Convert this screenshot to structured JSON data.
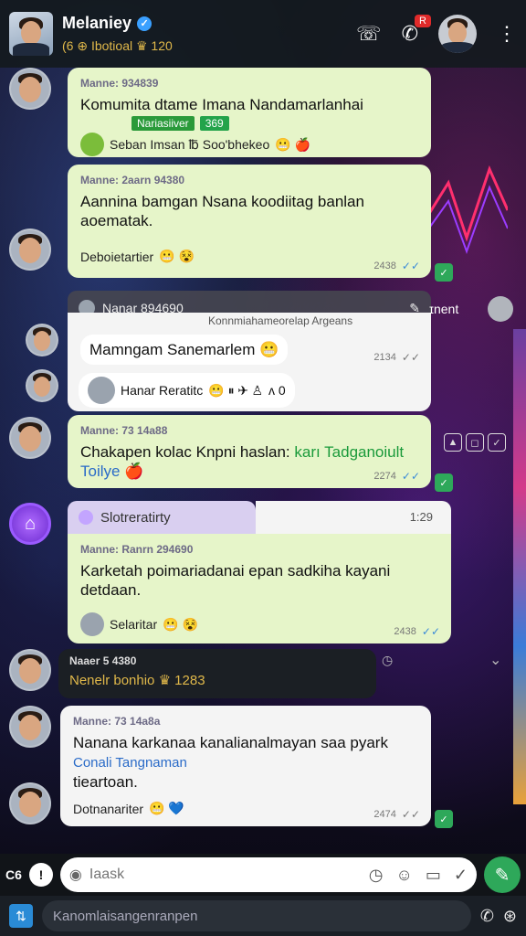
{
  "header": {
    "name": "Melaniey",
    "status": "(6 ⊕ Ibotioal ♛ 120",
    "call_badge": "R",
    "icons": [
      "call-back-icon",
      "call-icon",
      "more-icon"
    ]
  },
  "messages": [
    {
      "meta": "Manne: 934839",
      "text": "Komumita dtame Imana Nandamarlanhai",
      "tag": "Nariasiiver",
      "tag2": "369",
      "sub": "Seban Imsan ℔ Soo'bhekeo"
    },
    {
      "meta": "Manne: 2aarn 94380",
      "text": "Aannina bamgan Nsana koodiitag banlan aoematak.",
      "sub": "Deboietartier",
      "time": "2438"
    },
    {
      "reply_name": "Nanar 894690",
      "reply_sub": "Konnmiahameorelap Argeans",
      "text": "Mamngam Sanemarlem",
      "sub": "Hanar Reratitc",
      "sub_tail": "ʌ 0",
      "time": "2134"
    },
    {
      "meta": "Manne: 73 14a88",
      "text": "Chakapen kolac Knpni haslan:",
      "link": "karı Tadganoiult",
      "link2": "Toilye",
      "time": "2274"
    },
    {
      "quote": "Slotreratirty",
      "quote_time": "1:29",
      "meta": "Manne: Ranrn 294690",
      "text": "Karketah poimariadanai  epan sadkiha kayani detdaan.",
      "sub": "Selaritar",
      "time": "2438"
    },
    {
      "meta": "Naaer 5 4380",
      "text": "Nenelr bonhio ♛ 1283"
    },
    {
      "meta": "Manne: 73 14a8a",
      "text": "Nanana karkanaa kanalianalmayan saa pyark",
      "link": "Conali Tangnaman",
      "text2": "tieartoan.",
      "sub": "Dotnanariter",
      "time": "2474"
    }
  ],
  "side": {
    "label": "ɪnent",
    "icons": [
      "▲",
      "◻",
      "✓"
    ]
  },
  "input": {
    "lang": "C6",
    "placeholder": "Iaask"
  },
  "bottom": {
    "search": "Kanomlaisangenranpen"
  }
}
